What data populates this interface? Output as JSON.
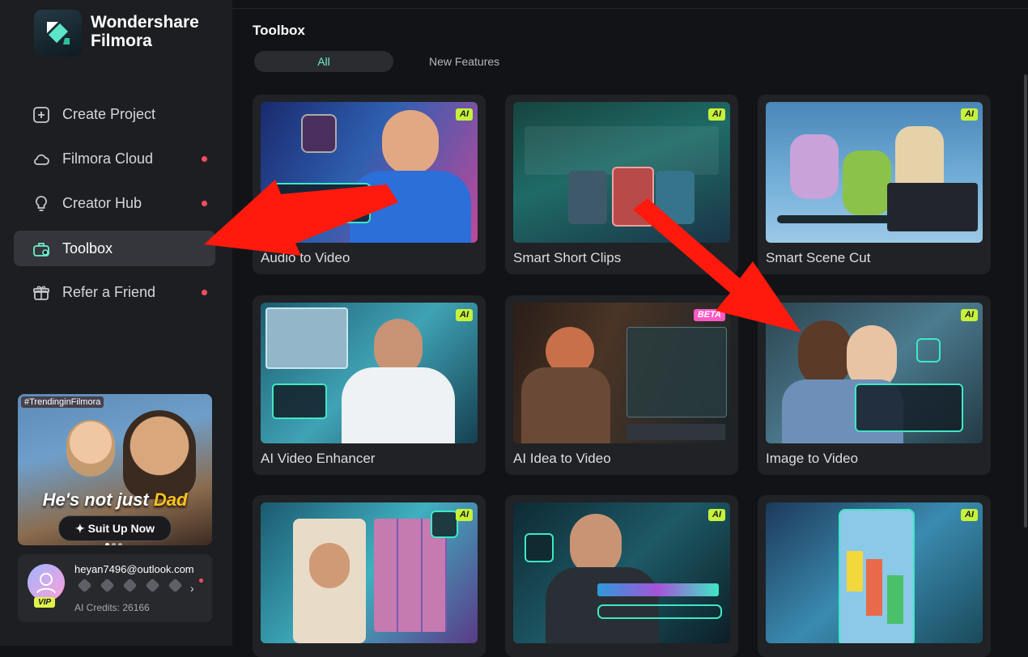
{
  "app": {
    "brand_line1": "Wondershare",
    "brand_line2": "Filmora"
  },
  "sidebar": {
    "items": [
      {
        "label": "Create Project",
        "icon": "plus-square-icon",
        "dot": false
      },
      {
        "label": "Filmora Cloud",
        "icon": "cloud-icon",
        "dot": true
      },
      {
        "label": "Creator Hub",
        "icon": "bulb-icon",
        "dot": true
      },
      {
        "label": "Toolbox",
        "icon": "toolbox-icon",
        "dot": false,
        "active": true
      },
      {
        "label": "Refer a Friend",
        "icon": "gift-icon",
        "dot": true
      }
    ],
    "promo": {
      "tag": "#TrendinginFilmora",
      "headline_a": "He's not just ",
      "headline_b": "Dad",
      "cta": "Suit Up Now"
    },
    "user": {
      "email": "heyan7496@outlook.com",
      "vip": "VIP",
      "credits": "AI Credits: 26166"
    }
  },
  "main": {
    "title": "Toolbox",
    "tabs": [
      {
        "label": "All",
        "active": true
      },
      {
        "label": "New Features",
        "active": false
      }
    ],
    "cards": [
      {
        "label": "Audio to Video",
        "badge": "AI"
      },
      {
        "label": "Smart Short Clips",
        "badge": "AI"
      },
      {
        "label": "Smart Scene Cut",
        "badge": "AI"
      },
      {
        "label": "AI Video Enhancer",
        "badge": "AI"
      },
      {
        "label": "AI Idea to Video",
        "badge": "BETA"
      },
      {
        "label": "Image to Video",
        "badge": "AI"
      },
      {
        "label": "",
        "badge": "AI"
      },
      {
        "label": "",
        "badge": "AI"
      },
      {
        "label": "",
        "badge": "AI"
      }
    ]
  },
  "colors": {
    "accent": "#6ef1d2",
    "ai_badge": "#c6f23a",
    "beta_badge": "#ff59c6",
    "annotation_arrow": "#ff1a0d"
  }
}
